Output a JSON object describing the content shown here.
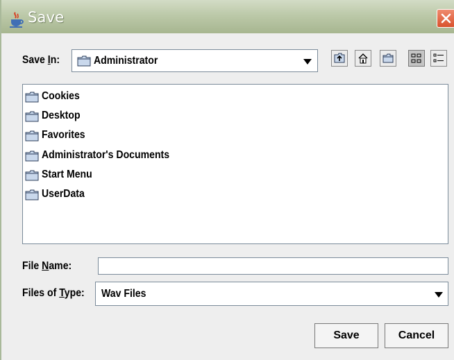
{
  "dialog": {
    "title": "Save"
  },
  "save_in": {
    "label_pre": "Save ",
    "label_key": "I",
    "label_post": "n:",
    "value": "Administrator"
  },
  "toolbar": {
    "buttons": [
      {
        "icon": "up-one-level-icon"
      },
      {
        "icon": "home-icon"
      },
      {
        "icon": "new-folder-icon"
      },
      {
        "icon": "list-view-icon",
        "active": true
      },
      {
        "icon": "details-view-icon"
      }
    ]
  },
  "files": {
    "items": [
      {
        "name": "Cookies"
      },
      {
        "name": "Desktop"
      },
      {
        "name": "Favorites"
      },
      {
        "name": "Administrator's Documents"
      },
      {
        "name": "Start Menu"
      },
      {
        "name": "UserData"
      }
    ]
  },
  "file_name": {
    "label_pre": "File ",
    "label_key": "N",
    "label_post": "ame:",
    "value": ""
  },
  "file_type": {
    "label_pre": "Files of ",
    "label_key": "T",
    "label_post": "ype:",
    "value": "Wav Files"
  },
  "buttons": {
    "save": "Save",
    "cancel": "Cancel"
  }
}
